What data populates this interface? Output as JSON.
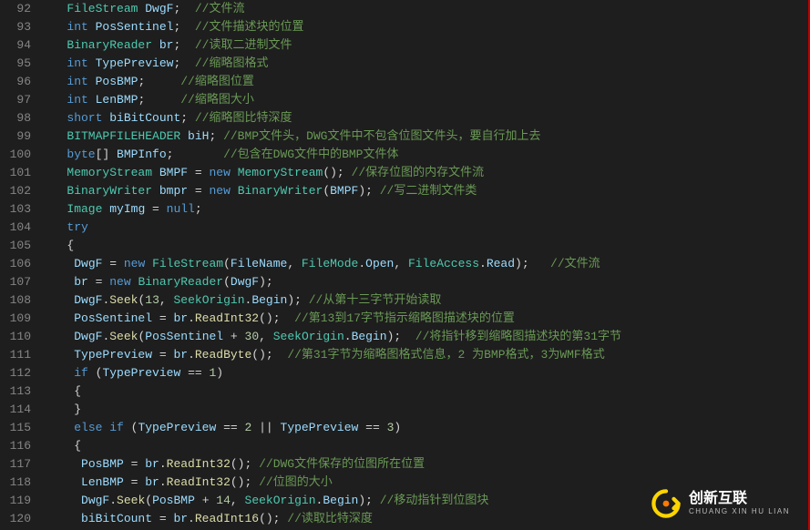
{
  "gutter": {
    "start": 92,
    "end": 120
  },
  "logo": {
    "cn": "创新互联",
    "en": "CHUANG XIN HU LIAN"
  },
  "lines": [
    {
      "n": 92,
      "t": [
        [
          "pn",
          "   "
        ],
        [
          "ty",
          "FileStream"
        ],
        [
          "pn",
          " "
        ],
        [
          "vr",
          "DwgF"
        ],
        [
          "pn",
          ";  "
        ],
        [
          "cm",
          "//文件流"
        ]
      ]
    },
    {
      "n": 93,
      "t": [
        [
          "pn",
          "   "
        ],
        [
          "kw",
          "int"
        ],
        [
          "pn",
          " "
        ],
        [
          "vr",
          "PosSentinel"
        ],
        [
          "pn",
          ";  "
        ],
        [
          "cm",
          "//文件描述块的位置"
        ]
      ]
    },
    {
      "n": 94,
      "t": [
        [
          "pn",
          "   "
        ],
        [
          "ty",
          "BinaryReader"
        ],
        [
          "pn",
          " "
        ],
        [
          "vr",
          "br"
        ],
        [
          "pn",
          ";  "
        ],
        [
          "cm",
          "//读取二进制文件"
        ]
      ]
    },
    {
      "n": 95,
      "t": [
        [
          "pn",
          "   "
        ],
        [
          "kw",
          "int"
        ],
        [
          "pn",
          " "
        ],
        [
          "vr",
          "TypePreview"
        ],
        [
          "pn",
          ";  "
        ],
        [
          "cm",
          "//缩略图格式"
        ]
      ]
    },
    {
      "n": 96,
      "t": [
        [
          "pn",
          "   "
        ],
        [
          "kw",
          "int"
        ],
        [
          "pn",
          " "
        ],
        [
          "vr",
          "PosBMP"
        ],
        [
          "pn",
          ";     "
        ],
        [
          "cm",
          "//缩略图位置"
        ]
      ]
    },
    {
      "n": 97,
      "t": [
        [
          "pn",
          "   "
        ],
        [
          "kw",
          "int"
        ],
        [
          "pn",
          " "
        ],
        [
          "vr",
          "LenBMP"
        ],
        [
          "pn",
          ";     "
        ],
        [
          "cm",
          "//缩略图大小"
        ]
      ]
    },
    {
      "n": 98,
      "t": [
        [
          "pn",
          "   "
        ],
        [
          "kw",
          "short"
        ],
        [
          "pn",
          " "
        ],
        [
          "vr",
          "biBitCount"
        ],
        [
          "pn",
          "; "
        ],
        [
          "cm",
          "//缩略图比特深度"
        ]
      ]
    },
    {
      "n": 99,
      "t": [
        [
          "pn",
          "   "
        ],
        [
          "ty",
          "BITMAPFILEHEADER"
        ],
        [
          "pn",
          " "
        ],
        [
          "vr",
          "biH"
        ],
        [
          "pn",
          "; "
        ],
        [
          "cm",
          "//BMP文件头，DWG文件中不包含位图文件头，要自行加上去"
        ]
      ]
    },
    {
      "n": 100,
      "t": [
        [
          "pn",
          "   "
        ],
        [
          "kw",
          "byte"
        ],
        [
          "pn",
          "[] "
        ],
        [
          "vr",
          "BMPInfo"
        ],
        [
          "pn",
          ";       "
        ],
        [
          "cm",
          "//包含在DWG文件中的BMP文件体"
        ]
      ]
    },
    {
      "n": 101,
      "t": [
        [
          "pn",
          "   "
        ],
        [
          "ty",
          "MemoryStream"
        ],
        [
          "pn",
          " "
        ],
        [
          "vr",
          "BMPF"
        ],
        [
          "pn",
          " = "
        ],
        [
          "kw",
          "new"
        ],
        [
          "pn",
          " "
        ],
        [
          "ty",
          "MemoryStream"
        ],
        [
          "pn",
          "(); "
        ],
        [
          "cm",
          "//保存位图的内存文件流"
        ]
      ]
    },
    {
      "n": 102,
      "t": [
        [
          "pn",
          "   "
        ],
        [
          "ty",
          "BinaryWriter"
        ],
        [
          "pn",
          " "
        ],
        [
          "vr",
          "bmpr"
        ],
        [
          "pn",
          " = "
        ],
        [
          "kw",
          "new"
        ],
        [
          "pn",
          " "
        ],
        [
          "ty",
          "BinaryWriter"
        ],
        [
          "pn",
          "("
        ],
        [
          "vr",
          "BMPF"
        ],
        [
          "pn",
          "); "
        ],
        [
          "cm",
          "//写二进制文件类"
        ]
      ]
    },
    {
      "n": 103,
      "t": [
        [
          "pn",
          "   "
        ],
        [
          "ty",
          "Image"
        ],
        [
          "pn",
          " "
        ],
        [
          "vr",
          "myImg"
        ],
        [
          "pn",
          " = "
        ],
        [
          "kw",
          "null"
        ],
        [
          "pn",
          ";"
        ]
      ]
    },
    {
      "n": 104,
      "t": [
        [
          "pn",
          "   "
        ],
        [
          "kw",
          "try"
        ]
      ]
    },
    {
      "n": 105,
      "t": [
        [
          "pn",
          "   {"
        ]
      ]
    },
    {
      "n": 106,
      "t": [
        [
          "pn",
          "    "
        ],
        [
          "vr",
          "DwgF"
        ],
        [
          "pn",
          " = "
        ],
        [
          "kw",
          "new"
        ],
        [
          "pn",
          " "
        ],
        [
          "ty",
          "FileStream"
        ],
        [
          "pn",
          "("
        ],
        [
          "vr",
          "FileName"
        ],
        [
          "pn",
          ", "
        ],
        [
          "ty",
          "FileMode"
        ],
        [
          "pn",
          "."
        ],
        [
          "vr",
          "Open"
        ],
        [
          "pn",
          ", "
        ],
        [
          "ty",
          "FileAccess"
        ],
        [
          "pn",
          "."
        ],
        [
          "vr",
          "Read"
        ],
        [
          "pn",
          ");   "
        ],
        [
          "cm",
          "//文件流"
        ]
      ]
    },
    {
      "n": 107,
      "t": [
        [
          "pn",
          "    "
        ],
        [
          "vr",
          "br"
        ],
        [
          "pn",
          " = "
        ],
        [
          "kw",
          "new"
        ],
        [
          "pn",
          " "
        ],
        [
          "ty",
          "BinaryReader"
        ],
        [
          "pn",
          "("
        ],
        [
          "vr",
          "DwgF"
        ],
        [
          "pn",
          ");"
        ]
      ]
    },
    {
      "n": 108,
      "t": [
        [
          "pn",
          "    "
        ],
        [
          "vr",
          "DwgF"
        ],
        [
          "pn",
          "."
        ],
        [
          "fn",
          "Seek"
        ],
        [
          "pn",
          "("
        ],
        [
          "nu",
          "13"
        ],
        [
          "pn",
          ", "
        ],
        [
          "ty",
          "SeekOrigin"
        ],
        [
          "pn",
          "."
        ],
        [
          "vr",
          "Begin"
        ],
        [
          "pn",
          "); "
        ],
        [
          "cm",
          "//从第十三字节开始读取"
        ]
      ]
    },
    {
      "n": 109,
      "t": [
        [
          "pn",
          "    "
        ],
        [
          "vr",
          "PosSentinel"
        ],
        [
          "pn",
          " = "
        ],
        [
          "vr",
          "br"
        ],
        [
          "pn",
          "."
        ],
        [
          "fn",
          "ReadInt32"
        ],
        [
          "pn",
          "();  "
        ],
        [
          "cm",
          "//第13到17字节指示缩略图描述块的位置"
        ]
      ]
    },
    {
      "n": 110,
      "t": [
        [
          "pn",
          "    "
        ],
        [
          "vr",
          "DwgF"
        ],
        [
          "pn",
          "."
        ],
        [
          "fn",
          "Seek"
        ],
        [
          "pn",
          "("
        ],
        [
          "vr",
          "PosSentinel"
        ],
        [
          "pn",
          " + "
        ],
        [
          "nu",
          "30"
        ],
        [
          "pn",
          ", "
        ],
        [
          "ty",
          "SeekOrigin"
        ],
        [
          "pn",
          "."
        ],
        [
          "vr",
          "Begin"
        ],
        [
          "pn",
          ");  "
        ],
        [
          "cm",
          "//将指针移到缩略图描述块的第31字节"
        ]
      ]
    },
    {
      "n": 111,
      "t": [
        [
          "pn",
          "    "
        ],
        [
          "vr",
          "TypePreview"
        ],
        [
          "pn",
          " = "
        ],
        [
          "vr",
          "br"
        ],
        [
          "pn",
          "."
        ],
        [
          "fn",
          "ReadByte"
        ],
        [
          "pn",
          "();  "
        ],
        [
          "cm",
          "//第31字节为缩略图格式信息，2 为BMP格式，3为WMF格式"
        ]
      ]
    },
    {
      "n": 112,
      "t": [
        [
          "pn",
          "    "
        ],
        [
          "kw",
          "if"
        ],
        [
          "pn",
          " ("
        ],
        [
          "vr",
          "TypePreview"
        ],
        [
          "pn",
          " == "
        ],
        [
          "nu",
          "1"
        ],
        [
          "pn",
          ")"
        ]
      ]
    },
    {
      "n": 113,
      "t": [
        [
          "pn",
          "    {"
        ]
      ]
    },
    {
      "n": 114,
      "t": [
        [
          "pn",
          "    }"
        ]
      ]
    },
    {
      "n": 115,
      "t": [
        [
          "pn",
          "    "
        ],
        [
          "kw",
          "else if"
        ],
        [
          "pn",
          " ("
        ],
        [
          "vr",
          "TypePreview"
        ],
        [
          "pn",
          " == "
        ],
        [
          "nu",
          "2"
        ],
        [
          "pn",
          " || "
        ],
        [
          "vr",
          "TypePreview"
        ],
        [
          "pn",
          " == "
        ],
        [
          "nu",
          "3"
        ],
        [
          "pn",
          ")"
        ]
      ]
    },
    {
      "n": 116,
      "t": [
        [
          "pn",
          "    {"
        ]
      ]
    },
    {
      "n": 117,
      "t": [
        [
          "pn",
          "     "
        ],
        [
          "vr",
          "PosBMP"
        ],
        [
          "pn",
          " = "
        ],
        [
          "vr",
          "br"
        ],
        [
          "pn",
          "."
        ],
        [
          "fn",
          "ReadInt32"
        ],
        [
          "pn",
          "(); "
        ],
        [
          "cm",
          "//DWG文件保存的位图所在位置"
        ]
      ]
    },
    {
      "n": 118,
      "t": [
        [
          "pn",
          "     "
        ],
        [
          "vr",
          "LenBMP"
        ],
        [
          "pn",
          " = "
        ],
        [
          "vr",
          "br"
        ],
        [
          "pn",
          "."
        ],
        [
          "fn",
          "ReadInt32"
        ],
        [
          "pn",
          "(); "
        ],
        [
          "cm",
          "//位图的大小"
        ]
      ]
    },
    {
      "n": 119,
      "t": [
        [
          "pn",
          "     "
        ],
        [
          "vr",
          "DwgF"
        ],
        [
          "pn",
          "."
        ],
        [
          "fn",
          "Seek"
        ],
        [
          "pn",
          "("
        ],
        [
          "vr",
          "PosBMP"
        ],
        [
          "pn",
          " + "
        ],
        [
          "nu",
          "14"
        ],
        [
          "pn",
          ", "
        ],
        [
          "ty",
          "SeekOrigin"
        ],
        [
          "pn",
          "."
        ],
        [
          "vr",
          "Begin"
        ],
        [
          "pn",
          "); "
        ],
        [
          "cm",
          "//移动指针到位图块"
        ]
      ]
    },
    {
      "n": 120,
      "t": [
        [
          "pn",
          "     "
        ],
        [
          "vr",
          "biBitCount"
        ],
        [
          "pn",
          " = "
        ],
        [
          "vr",
          "br"
        ],
        [
          "pn",
          "."
        ],
        [
          "fn",
          "ReadInt16"
        ],
        [
          "pn",
          "(); "
        ],
        [
          "cm",
          "//读取比特深度"
        ]
      ]
    }
  ]
}
